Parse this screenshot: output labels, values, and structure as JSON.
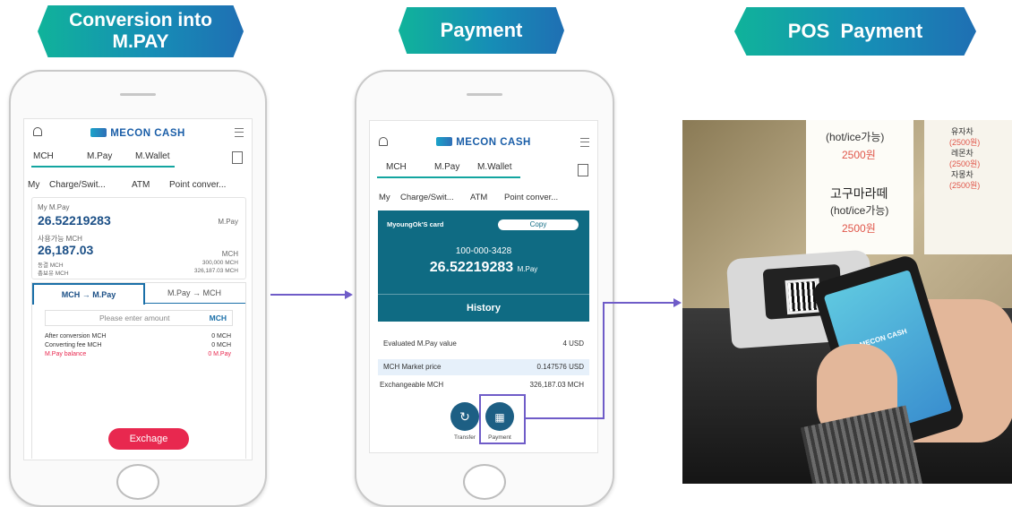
{
  "banners": {
    "conversion": "Conversion into M.PAY",
    "payment": "Payment",
    "pos": "POS  Payment"
  },
  "brand": "MECON CASH",
  "tabs": [
    "MCH",
    "M.Pay",
    "M.Wallet"
  ],
  "phone1": {
    "subnav": [
      "My",
      "Charge/Swit...",
      "ATM",
      "Point conver..."
    ],
    "mypay_label": "My M.Pay",
    "mypay_value": "26.52219283",
    "mypay_unit": "M.Pay",
    "avail_label": "사용가능 MCH",
    "avail_value": "26,187.03",
    "avail_unit": "MCH",
    "frozen_label": "동결 MCH",
    "frozen_value": "300,000 MCH",
    "held_label": "총보유 MCH",
    "held_value": "326,187.03 MCH",
    "conv_tab_active": "MCH → M.Pay",
    "conv_tab_other": "M.Pay → MCH",
    "amount_placeholder": "Please enter amount",
    "amount_unit": "MCH",
    "rows": [
      {
        "label": "After conversion MCH",
        "value": "0 MCH"
      },
      {
        "label": "Converting fee MCH",
        "value": "0 MCH"
      },
      {
        "label": "M.Pay balance",
        "value": "0 M.Pay"
      }
    ],
    "exchange_button": "Exchage"
  },
  "phone2": {
    "subnav": [
      "My",
      "Charge/Swit...",
      "ATM",
      "Point conver..."
    ],
    "card_owner": "MyoungOk'S card",
    "copy_button": "Copy",
    "card_number": "100-000-3428",
    "card_balance": "26.52219283",
    "card_unit": "M.Pay",
    "history_button": "History",
    "evaluated_label": "Evaluated M.Pay value",
    "evaluated_value": "4 USD",
    "market_label": "MCH Market price",
    "market_value": "0.147576 USD",
    "exchangeable_label": "Exchangeable MCH",
    "exchangeable_value": "326,187.03 MCH",
    "transfer_label": "Transfer",
    "payment_label": "Payment"
  },
  "photo": {
    "menu1": "(hot/ice가능)",
    "price1": "2500원",
    "menu2": "고구마라떼",
    "menu3": "(hot/ice가능)",
    "price2": "2500원",
    "side1": "유자차",
    "side2": "(2500원)",
    "side3": "레몬차",
    "side4": "(2500원)",
    "side5": "자몽차",
    "side6": "(2500원)",
    "phone_brand": "MECON CASH"
  },
  "colors": {
    "accent": "#13a5a0",
    "brand_blue": "#1a5ea8",
    "connector": "#6f5cc8",
    "exchange_red": "#e8284f",
    "card_teal": "#0f6b83"
  }
}
